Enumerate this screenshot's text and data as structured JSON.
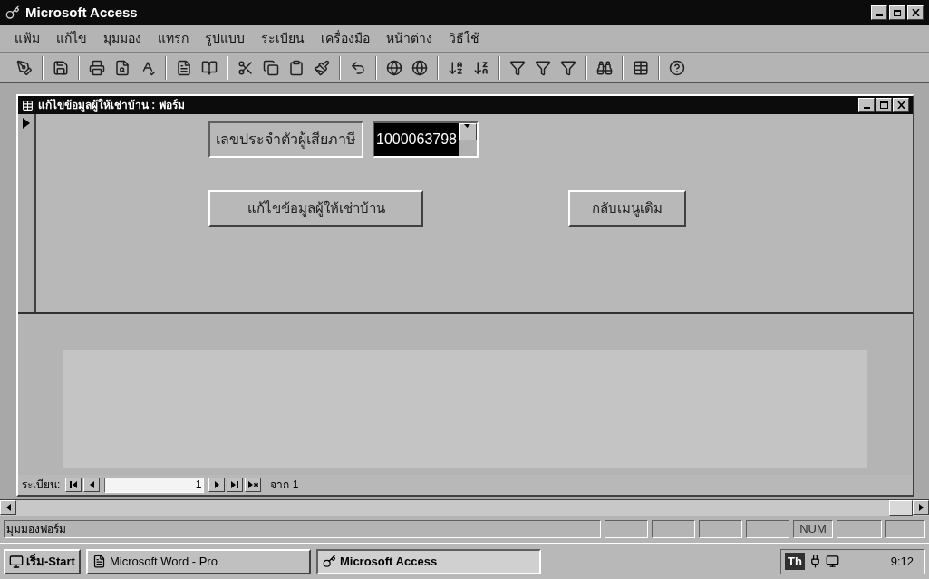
{
  "window": {
    "title": "Microsoft Access"
  },
  "menu": [
    "แฟ้ม",
    "แก้ไข",
    "มุมมอง",
    "แทรก",
    "รูปแบบ",
    "ระเบียน",
    "เครื่องมือ",
    "หน้าต่าง",
    "วิธีใช้"
  ],
  "form_window": {
    "title": "แก้ไขข้อมูลผู้ให้เช่าบ้าน : ฟอร์ม",
    "taxpayer_label": "เลขประจำตัวผู้เสียภาษี",
    "taxpayer_combo": {
      "value": "1000063798",
      "highlighted": true
    },
    "buttons": [
      "แก้ไขข้อมูลผู้ให้เช่าบ้าน",
      "กลับเมนูเดิม"
    ],
    "navigation": {
      "label": "ระเบียน:",
      "record": "1",
      "total": "จาก 1"
    }
  },
  "status_bar": {
    "text": "มุมมองฟอร์ม",
    "indicators": [
      {
        "text": "NUM",
        "on": true
      }
    ]
  },
  "taskbar": {
    "start": "เริ่ม-Start",
    "tasks": [
      {
        "label": "Microsoft Word - Pro",
        "selected": false
      },
      {
        "label": "Microsoft Access",
        "selected": true
      }
    ],
    "tray_language": "Th",
    "clock": "9:12"
  }
}
